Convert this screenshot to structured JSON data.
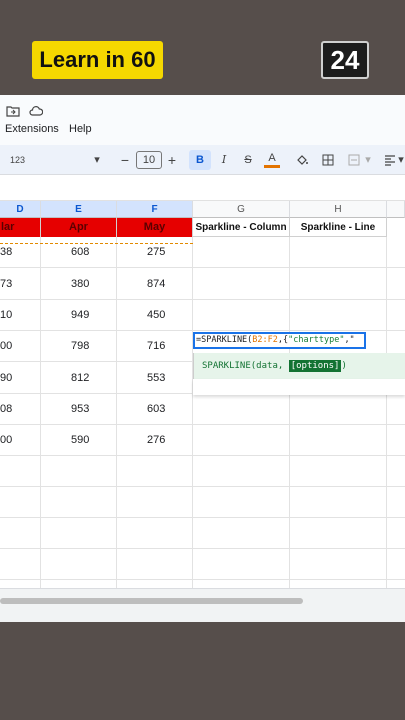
{
  "overlay": {
    "learn_label": "Learn in 60",
    "counter": "24"
  },
  "menu": {
    "extensions": "Extensions",
    "help": "Help"
  },
  "toolbar": {
    "number_format": "123",
    "font_size": "10",
    "bold": "B",
    "italic": "I",
    "strike": "S",
    "text_color": "A"
  },
  "columns": {
    "D": "D",
    "E": "E",
    "F": "F",
    "G": "G",
    "H": "H"
  },
  "headers": {
    "mar": "lar",
    "apr": "Apr",
    "may": "May",
    "spark_col": "Sparkline - Column",
    "spark_line": "Sparkline - Line"
  },
  "rows": [
    {
      "d": "38",
      "e": "608",
      "f": "275"
    },
    {
      "d": "73",
      "e": "380",
      "f": "874"
    },
    {
      "d": "10",
      "e": "949",
      "f": "450"
    },
    {
      "d": "00",
      "e": "798",
      "f": "716"
    },
    {
      "d": "90",
      "e": "812",
      "f": "553"
    },
    {
      "d": "08",
      "e": "953",
      "f": "603"
    },
    {
      "d": "00",
      "e": "590",
      "f": "276"
    }
  ],
  "formula": {
    "prefix": "=SPARKLINE(",
    "ref": "B2:F2",
    "sep": ",{",
    "arg": "\"charttype\"",
    "tail": ",\""
  },
  "hint": {
    "func": "SPARKLINE(data, ",
    "options": "[options]",
    "close": ")"
  },
  "colors": {
    "header_red": "#e60000",
    "selection_blue": "#1a73e8",
    "hint_green": "#e6f4ea",
    "badge_yellow": "#f5d800"
  }
}
